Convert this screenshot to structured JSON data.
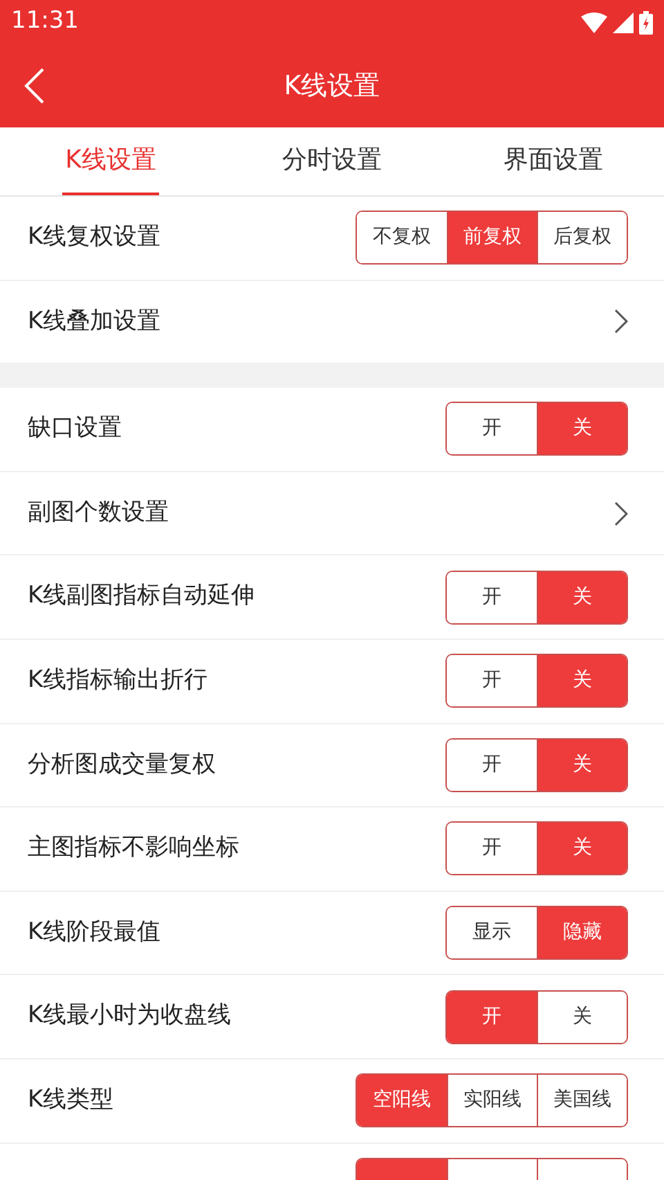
{
  "status_bar": {
    "time": "11:31"
  },
  "header": {
    "title": "K线设置"
  },
  "tabs": [
    {
      "label": "K线设置",
      "selected": true
    },
    {
      "label": "分时设置",
      "selected": false
    },
    {
      "label": "界面设置",
      "selected": false
    }
  ],
  "groups": [
    {
      "rows": [
        {
          "kind": "segment",
          "label": "K线复权设置",
          "options": [
            {
              "label": "不复权",
              "selected": false
            },
            {
              "label": "前复权",
              "selected": true
            },
            {
              "label": "后复权",
              "selected": false
            }
          ]
        },
        {
          "kind": "link",
          "label": "K线叠加设置"
        }
      ]
    },
    {
      "rows": [
        {
          "kind": "segment",
          "label": "缺口设置",
          "options": [
            {
              "label": "开",
              "selected": false
            },
            {
              "label": "关",
              "selected": true
            }
          ]
        },
        {
          "kind": "link",
          "label": "副图个数设置"
        },
        {
          "kind": "segment",
          "label": "K线副图指标自动延伸",
          "options": [
            {
              "label": "开",
              "selected": false
            },
            {
              "label": "关",
              "selected": true
            }
          ]
        },
        {
          "kind": "segment",
          "label": "K线指标输出折行",
          "options": [
            {
              "label": "开",
              "selected": false
            },
            {
              "label": "关",
              "selected": true
            }
          ]
        },
        {
          "kind": "segment",
          "label": "分析图成交量复权",
          "options": [
            {
              "label": "开",
              "selected": false
            },
            {
              "label": "关",
              "selected": true
            }
          ]
        },
        {
          "kind": "segment",
          "label": "主图指标不影响坐标",
          "options": [
            {
              "label": "开",
              "selected": false
            },
            {
              "label": "关",
              "selected": true
            }
          ]
        },
        {
          "kind": "segment",
          "label": "K线阶段最值",
          "options": [
            {
              "label": "显示",
              "selected": false
            },
            {
              "label": "隐藏",
              "selected": true
            }
          ]
        },
        {
          "kind": "segment",
          "label": "K线最小时为收盘线",
          "options": [
            {
              "label": "开",
              "selected": true
            },
            {
              "label": "关",
              "selected": false
            }
          ]
        },
        {
          "kind": "segment",
          "label": "K线类型",
          "options": [
            {
              "label": "空阳线",
              "selected": true
            },
            {
              "label": "实阳线",
              "selected": false
            },
            {
              "label": "美国线",
              "selected": false
            }
          ]
        },
        {
          "kind": "segment",
          "options": [
            {
              "selected": true
            },
            {
              "selected": false
            },
            {
              "selected": false
            }
          ]
        }
      ]
    }
  ]
}
